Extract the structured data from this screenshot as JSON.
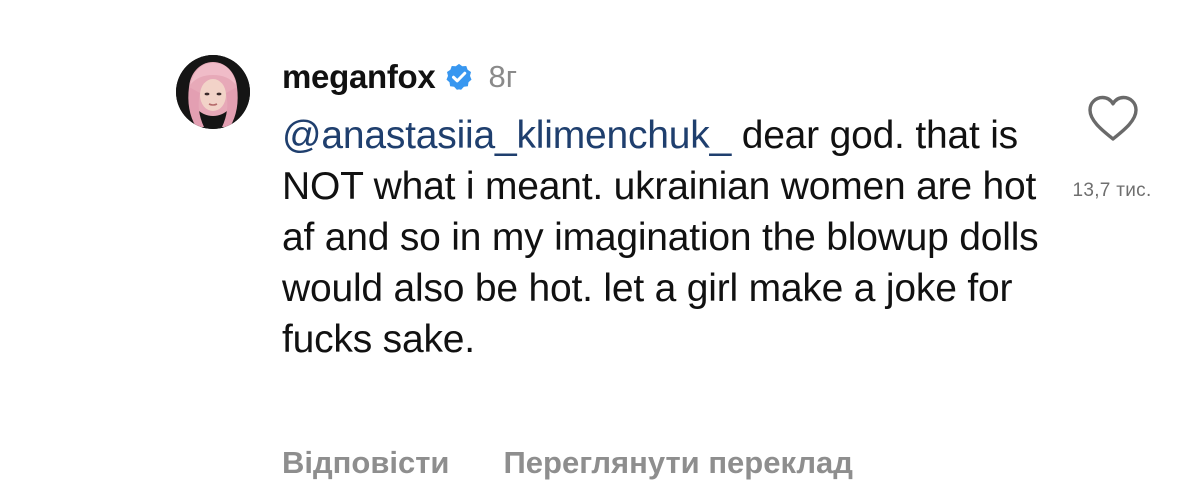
{
  "comment": {
    "username": "meganfox",
    "verified_icon": "verified-badge-icon",
    "timestamp": "8г",
    "mention": "@anastasiia_klimenchuk_",
    "text": " dear god. that is NOT what i meant. ukrainian women are hot af and so in my imagination the blowup dolls would also be hot. let a girl make a joke for fucks sake.",
    "like_icon": "heart-outline-icon",
    "like_count": "13,7 тис.",
    "actions": {
      "reply_label": "Відповісти",
      "translate_label": "Переглянути переклад"
    }
  },
  "colors": {
    "mention": "#1f3f6e",
    "verified": "#3897f0",
    "muted": "#8e8e8e"
  }
}
